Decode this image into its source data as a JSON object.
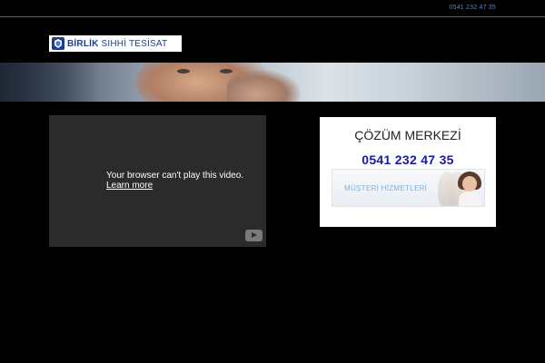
{
  "header": {
    "phone": "0541 232 47 35"
  },
  "logo": {
    "brand_bold": "BİRLİK",
    "brand_thin": " SIHHİ TESİSAT",
    "colors": {
      "primary": "#1d3f8f"
    }
  },
  "video": {
    "message": "Your browser can't play this video.",
    "learn_more": "Learn more",
    "icon": "youtube-icon"
  },
  "support_panel": {
    "title": "ÇÖZÜM MERKEZİ",
    "phone": "0541 232 47 35",
    "banner_text": "MÜŞTERİ HİZMETLERİ",
    "colors": {
      "phone": "#1a1aa0",
      "banner_text": "#7fb0d8"
    }
  }
}
